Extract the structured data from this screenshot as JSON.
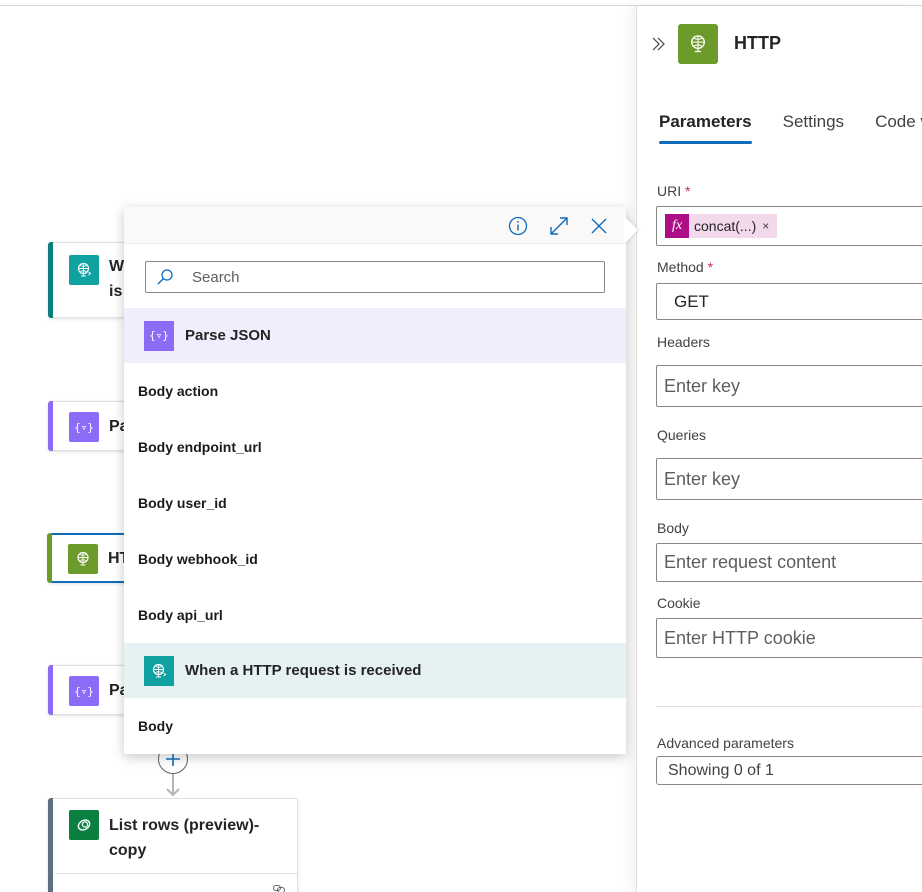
{
  "canvas": {
    "nodes": [
      {
        "title": "W\nis",
        "icon": "http-request-trigger-icon",
        "accent": "#0b7e7e",
        "icon_bg": "#10a1a1"
      },
      {
        "title": "Pa",
        "icon": "parse-json-icon",
        "accent": "#8c6cf6",
        "icon_bg": "#8c6cf6"
      },
      {
        "title": "HT",
        "icon": "http-globe-icon",
        "accent": "#6c9a2b",
        "icon_bg": "#6c9a2b",
        "selected": true
      },
      {
        "title": "Pa",
        "icon": "parse-json-icon",
        "accent": "#8c6cf6",
        "icon_bg": "#8c6cf6"
      },
      {
        "title": "List rows (preview)-\ncopy",
        "icon": "dataverse-icon",
        "accent": "#5f6f80",
        "icon_bg": "#0b7f3f"
      }
    ],
    "add_button_icon": "plus-icon"
  },
  "dynamic_content": {
    "header_icons": [
      "info-icon",
      "expand-icon",
      "close-icon"
    ],
    "search_placeholder": "Search",
    "groups": [
      {
        "label": "Parse JSON",
        "icon": "parse-json-icon",
        "color": "#8c6cf6",
        "items": [
          "Body action",
          "Body endpoint_url",
          "Body user_id",
          "Body webhook_id",
          "Body api_url"
        ]
      },
      {
        "label": "When a HTTP request is received",
        "icon": "http-request-trigger-icon",
        "color": "#10a1a1",
        "items": [
          "Body"
        ]
      }
    ]
  },
  "panel": {
    "title": "HTTP",
    "icon_color": "#6c9a2b",
    "tabs": [
      {
        "label": "Parameters",
        "active": true
      },
      {
        "label": "Settings",
        "active": false
      },
      {
        "label": "Code view",
        "active": false
      }
    ],
    "fields": {
      "uri": {
        "label": "URI",
        "required": "*",
        "token_text": "concat(...)",
        "token_fx": "fx",
        "token_remove": "×"
      },
      "method": {
        "label": "Method",
        "required": "*",
        "value": "GET"
      },
      "headers": {
        "label": "Headers",
        "placeholder": "Enter key"
      },
      "queries": {
        "label": "Queries",
        "placeholder": "Enter key"
      },
      "body": {
        "label": "Body",
        "placeholder": "Enter request content"
      },
      "cookie": {
        "label": "Cookie",
        "placeholder": "Enter HTTP cookie"
      }
    },
    "advanced": {
      "label": "Advanced parameters",
      "value": "Showing 0 of 1"
    }
  }
}
